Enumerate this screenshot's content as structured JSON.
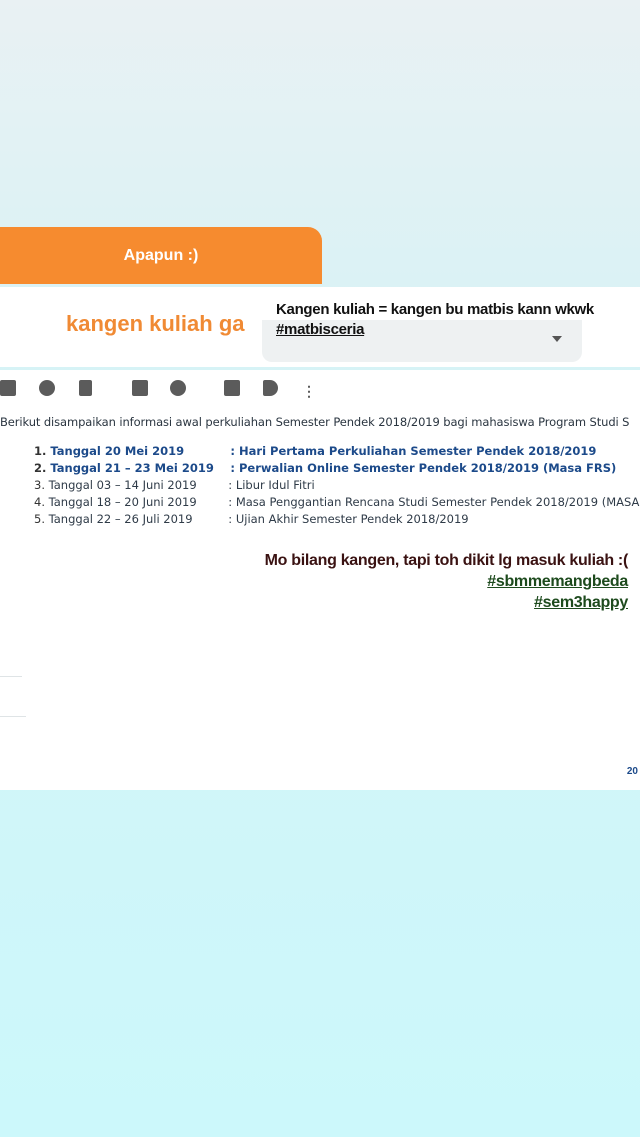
{
  "question_sticker": {
    "question": "Apapun :)",
    "answer": "kangen kuliah ga"
  },
  "caption_top": {
    "text": "Kangen kuliah = kangen bu matbis kann wkwk",
    "hashtag": "#matbisceria"
  },
  "email": {
    "toolbar_icons": [
      "archive-icon",
      "report-spam-icon",
      "delete-icon",
      "mark-unread-icon",
      "snooze-icon",
      "move-to-icon",
      "label-icon",
      "more-icon"
    ],
    "intro": "Berikut disampaikan informasi awal perkuliahan Semester Pendek 2018/2019 bagi mahasiswa Program Studi S",
    "schedule": [
      {
        "num": "1.",
        "date": "Tanggal 20 Mei 2019",
        "desc": ": Hari Pertama Perkuliahan Semester Pendek 2018/2019"
      },
      {
        "num": "2.",
        "date": "Tanggal 21 – 23 Mei 2019",
        "desc": ": Perwalian Online Semester Pendek 2018/2019  (Masa FRS)"
      },
      {
        "num": "3.",
        "date": "Tanggal 03 – 14 Juni 2019",
        "desc": ": Libur Idul Fitri"
      },
      {
        "num": "4.",
        "date": "Tanggal 18 – 20 Juni 2019",
        "desc": ": Masa Penggantian Rencana Studi Semester Pendek 2018/2019 (MASA"
      },
      {
        "num": "5.",
        "date": "Tanggal 22 – 26 Juli 2019",
        "desc": ": Ujian Akhir Semester Pendek 2018/2019"
      }
    ],
    "corner_text": "20"
  },
  "caption_bottom": {
    "text": "Mo bilang kangen, tapi toh dikit lg masuk kuliah :(",
    "hashtags": [
      "#sbmmemangbeda",
      "#sem3happy"
    ]
  }
}
